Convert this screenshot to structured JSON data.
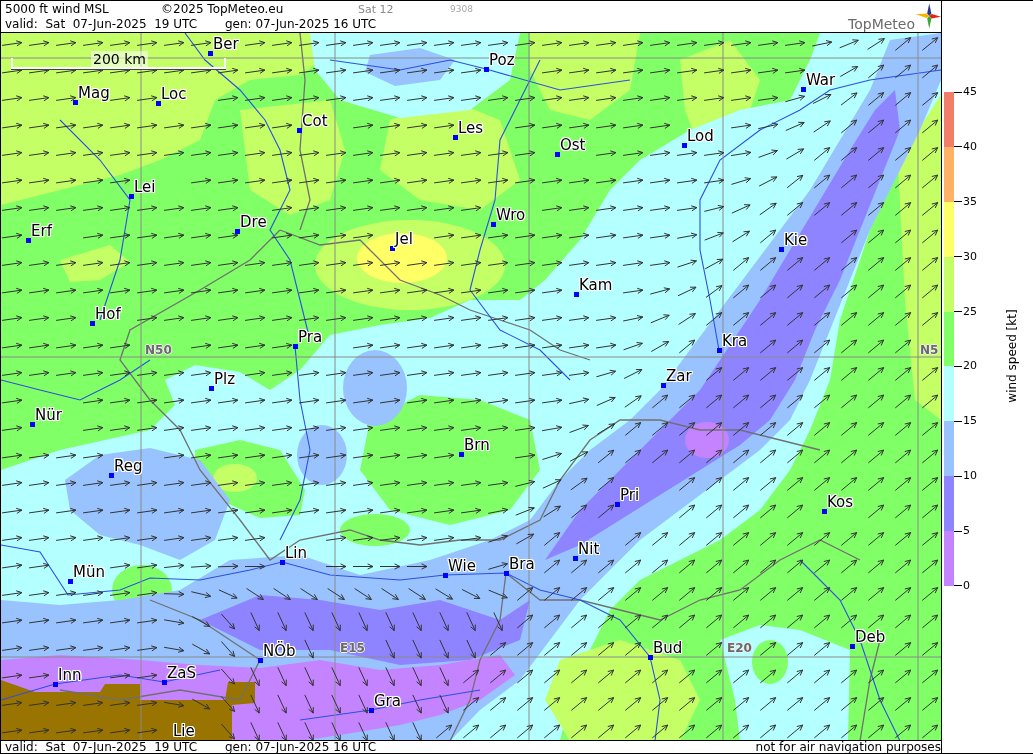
{
  "header": {
    "title": "5000 ft wind MSL",
    "copyright": "©2025 TopMeteo.eu",
    "run": "Sat 12",
    "code": "9308",
    "valid": "valid:  Sat  07-Jun-2025  19 UTC",
    "generated": "gen: 07-Jun-2025 16 UTC",
    "logo": "TopMeteo"
  },
  "map": {
    "scale_bar": "200 km",
    "grid_labels": [
      "N50",
      "N5",
      "E15",
      "E20"
    ],
    "cities": [
      "Ber",
      "Poz",
      "War",
      "Mag",
      "Loc",
      "Cot",
      "Les",
      "Lod",
      "Ost",
      "Lei",
      "Dre",
      "Wro",
      "Erf",
      "Jel",
      "Kie",
      "Kam",
      "Hof",
      "Pra",
      "Kra",
      "Zar",
      "Plz",
      "Nür",
      "Brn",
      "Reg",
      "Pri",
      "Kos",
      "Lin",
      "Nit",
      "Wie",
      "Bra",
      "Mün",
      "Deb",
      "Bud",
      "NÖb",
      "Inn",
      "ZaS",
      "Gra",
      "Lie"
    ]
  },
  "legend": {
    "title": "wind speed [kt]",
    "ticks": [
      "45",
      "40",
      "35",
      "30",
      "25",
      "20",
      "15",
      "10",
      "5",
      "0"
    ],
    "bands": [
      {
        "color": "#f27e6a"
      },
      {
        "color": "#ffb266"
      },
      {
        "color": "#ffff66"
      },
      {
        "color": "#c4ff66"
      },
      {
        "color": "#80ff66"
      },
      {
        "color": "#b4ffff"
      },
      {
        "color": "#99c3ff"
      },
      {
        "color": "#8f84ff"
      },
      {
        "color": "#c584ff"
      }
    ]
  },
  "footer": {
    "valid": "valid:  Sat  07-Jun-2025  19 UTC",
    "generated": "gen: 07-Jun-2025 16 UTC",
    "disclaimer": "not for air navigation purposes"
  }
}
